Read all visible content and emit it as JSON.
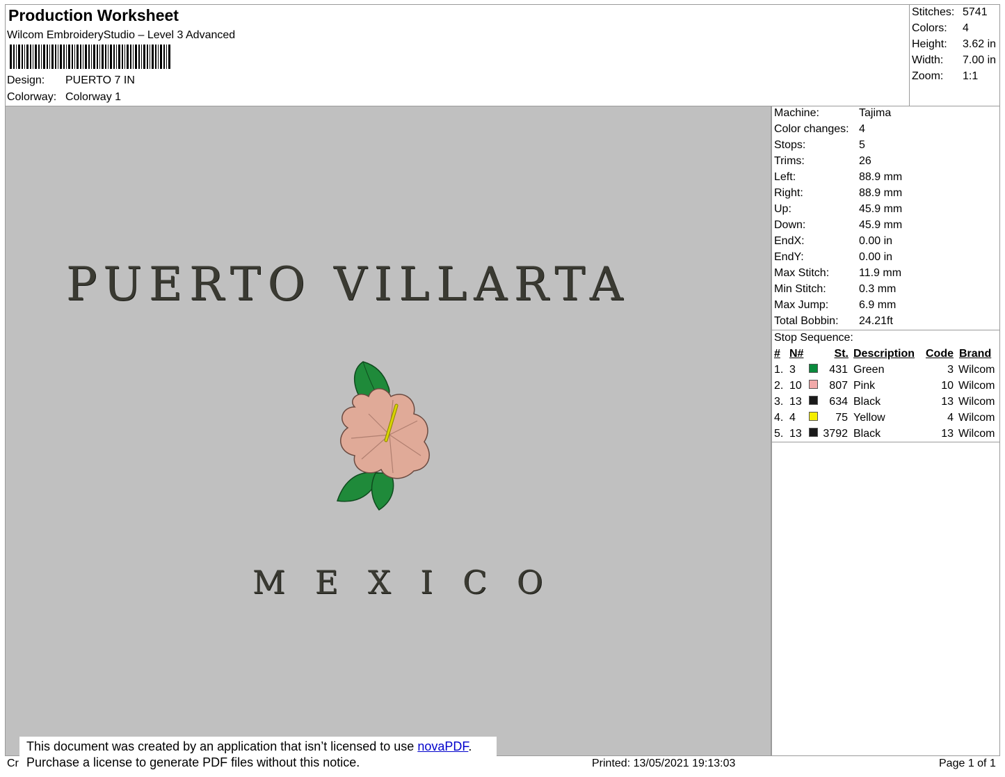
{
  "header": {
    "title": "Production Worksheet",
    "subtitle": "Wilcom EmbroideryStudio – Level 3 Advanced",
    "design_label": "Design:",
    "design_value": "PUERTO 7 IN",
    "colorway_label": "Colorway:",
    "colorway_value": "Colorway 1"
  },
  "summary": [
    {
      "label": "Stitches:",
      "value": "5741"
    },
    {
      "label": "Colors:",
      "value": "4"
    },
    {
      "label": "Height:",
      "value": "3.62 in"
    },
    {
      "label": "Width:",
      "value": "7.00 in"
    },
    {
      "label": "Zoom:",
      "value": "1:1"
    }
  ],
  "details": [
    {
      "label": "Machine:",
      "value": "Tajima"
    },
    {
      "label": "Color changes:",
      "value": "4"
    },
    {
      "label": "Stops:",
      "value": "5"
    },
    {
      "label": "Trims:",
      "value": "26"
    },
    {
      "label": "Left:",
      "value": "88.9 mm"
    },
    {
      "label": "Right:",
      "value": "88.9 mm"
    },
    {
      "label": "Up:",
      "value": "45.9 mm"
    },
    {
      "label": "Down:",
      "value": "45.9 mm"
    },
    {
      "label": "EndX:",
      "value": "0.00 in"
    },
    {
      "label": "EndY:",
      "value": "0.00 in"
    },
    {
      "label": "Max Stitch:",
      "value": "11.9 mm"
    },
    {
      "label": "Min Stitch:",
      "value": "0.3 mm"
    },
    {
      "label": "Max Jump:",
      "value": "6.9 mm"
    },
    {
      "label": "Total Bobbin:",
      "value": "24.21ft"
    }
  ],
  "stop_sequence": {
    "title": "Stop Sequence:",
    "headers": {
      "num": "#",
      "n": "N#",
      "st": "St.",
      "desc": "Description",
      "code": "Code",
      "brand": "Brand"
    },
    "rows": [
      {
        "num": "1.",
        "n": "3",
        "color": "#0a8a3c",
        "st": "431",
        "desc": "Green",
        "code": "3",
        "brand": "Wilcom"
      },
      {
        "num": "2.",
        "n": "10",
        "color": "#f1a9a9",
        "st": "807",
        "desc": "Pink",
        "code": "10",
        "brand": "Wilcom"
      },
      {
        "num": "3.",
        "n": "13",
        "color": "#1a1a1a",
        "st": "634",
        "desc": "Black",
        "code": "13",
        "brand": "Wilcom"
      },
      {
        "num": "4.",
        "n": "4",
        "color": "#f5ee00",
        "st": "75",
        "desc": "Yellow",
        "code": "4",
        "brand": "Wilcom"
      },
      {
        "num": "5.",
        "n": "13",
        "color": "#1a1a1a",
        "st": "3792",
        "desc": "Black",
        "code": "13",
        "brand": "Wilcom"
      }
    ]
  },
  "design": {
    "line1": "PUERTO VILLARTA",
    "line2": "M E X I C O",
    "colors": {
      "background": "#c0c0c0",
      "text": "#3a3a32",
      "leaf": "#1f8a3a",
      "petal": "#e0aa98",
      "stamen": "#d9d400"
    }
  },
  "notice": {
    "line1_prefix": "This document was created by an application that isn’t licensed to use ",
    "link": "novaPDF",
    "line1_suffix": ".",
    "line2": "Purchase a license to generate PDF files without this notice."
  },
  "footer": {
    "left": "Cr",
    "printed": "Printed: 13/05/2021 19:13:03",
    "page": "Page 1 of 1"
  }
}
